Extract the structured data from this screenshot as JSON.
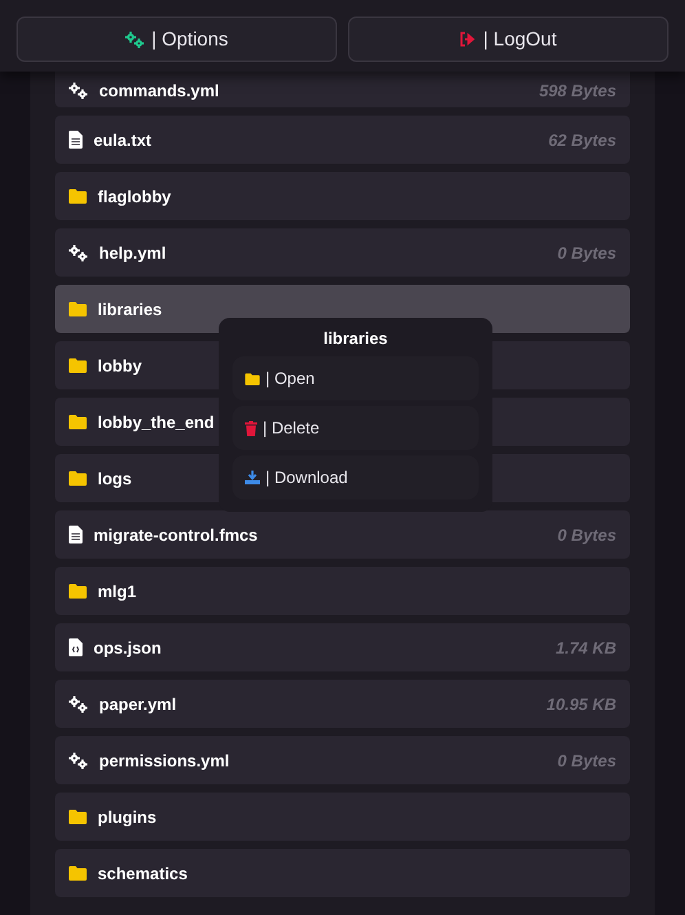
{
  "header": {
    "buttons": [
      {
        "kind": "options",
        "label": "| Options"
      },
      {
        "kind": "logout",
        "label": "| LogOut"
      }
    ]
  },
  "files": [
    {
      "kind": "config",
      "name": "commands.yml",
      "size": "598 Bytes",
      "selected": false
    },
    {
      "kind": "file",
      "name": "eula.txt",
      "size": "62 Bytes",
      "selected": false
    },
    {
      "kind": "folder",
      "name": "flaglobby",
      "selected": false
    },
    {
      "kind": "config",
      "name": "help.yml",
      "size": "0 Bytes",
      "selected": false
    },
    {
      "kind": "folder",
      "name": "libraries",
      "selected": true
    },
    {
      "kind": "folder",
      "name": "lobby",
      "selected": false
    },
    {
      "kind": "folder",
      "name": "lobby_the_end",
      "selected": false
    },
    {
      "kind": "folder",
      "name": "logs",
      "selected": false
    },
    {
      "kind": "file",
      "name": "migrate-control.fmcs",
      "size": "0 Bytes",
      "selected": false
    },
    {
      "kind": "folder",
      "name": "mlg1",
      "selected": false
    },
    {
      "kind": "code",
      "name": "ops.json",
      "size": "1.74 KB",
      "selected": false
    },
    {
      "kind": "config",
      "name": "paper.yml",
      "size": "10.95 KB",
      "selected": false
    },
    {
      "kind": "config",
      "name": "permissions.yml",
      "size": "0 Bytes",
      "selected": false
    },
    {
      "kind": "folder",
      "name": "plugins",
      "selected": false
    },
    {
      "kind": "folder",
      "name": "schematics",
      "selected": false
    }
  ],
  "context_menu": {
    "title": "libraries",
    "items": [
      {
        "kind": "open",
        "label": "| Open"
      },
      {
        "kind": "delete",
        "label": "| Delete"
      },
      {
        "kind": "download",
        "label": "| Download"
      }
    ]
  }
}
